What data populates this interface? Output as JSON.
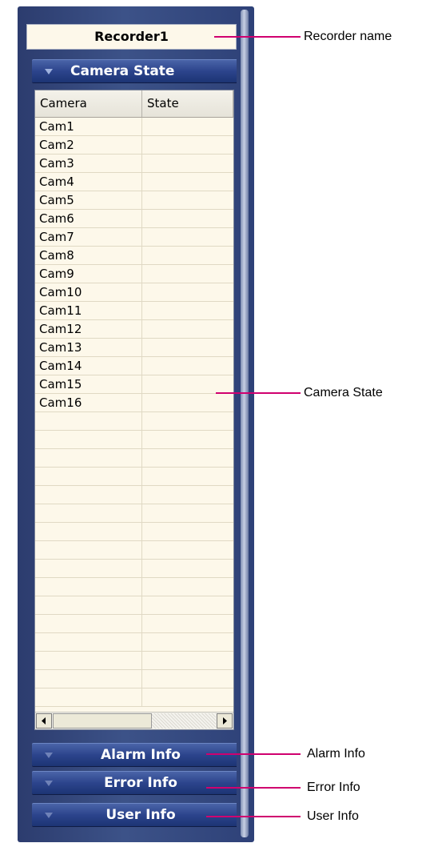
{
  "recorder": {
    "name": "Recorder1"
  },
  "sections": {
    "camera_state": "Camera State",
    "alarm_info": "Alarm Info",
    "error_info": "Error Info",
    "user_info": "User Info"
  },
  "table": {
    "columns": [
      "Camera",
      "State"
    ],
    "rows": [
      {
        "camera": "Cam1",
        "state": ""
      },
      {
        "camera": "Cam2",
        "state": ""
      },
      {
        "camera": "Cam3",
        "state": ""
      },
      {
        "camera": "Cam4",
        "state": ""
      },
      {
        "camera": "Cam5",
        "state": ""
      },
      {
        "camera": "Cam6",
        "state": ""
      },
      {
        "camera": "Cam7",
        "state": ""
      },
      {
        "camera": "Cam8",
        "state": ""
      },
      {
        "camera": "Cam9",
        "state": ""
      },
      {
        "camera": "Cam10",
        "state": ""
      },
      {
        "camera": "Cam11",
        "state": ""
      },
      {
        "camera": "Cam12",
        "state": ""
      },
      {
        "camera": "Cam13",
        "state": ""
      },
      {
        "camera": "Cam14",
        "state": ""
      },
      {
        "camera": "Cam15",
        "state": ""
      },
      {
        "camera": "Cam16",
        "state": ""
      },
      {
        "camera": "",
        "state": ""
      },
      {
        "camera": "",
        "state": ""
      },
      {
        "camera": "",
        "state": ""
      },
      {
        "camera": "",
        "state": ""
      },
      {
        "camera": "",
        "state": ""
      },
      {
        "camera": "",
        "state": ""
      },
      {
        "camera": "",
        "state": ""
      },
      {
        "camera": "",
        "state": ""
      },
      {
        "camera": "",
        "state": ""
      },
      {
        "camera": "",
        "state": ""
      },
      {
        "camera": "",
        "state": ""
      },
      {
        "camera": "",
        "state": ""
      },
      {
        "camera": "",
        "state": ""
      },
      {
        "camera": "",
        "state": ""
      },
      {
        "camera": "",
        "state": ""
      },
      {
        "camera": "",
        "state": ""
      }
    ]
  },
  "annotations": {
    "recorder_name": "Recorder name",
    "camera_state": "Camera State",
    "alarm_info": "Alarm Info",
    "error_info": "Error Info",
    "user_info": "User Info"
  },
  "icons": {
    "section_toggle": "triangle-down-icon",
    "scroll_left": "arrow-left-icon",
    "scroll_right": "arrow-right-icon"
  },
  "colors": {
    "panel_blue": "#2c448c",
    "table_background": "#fdf8ea",
    "callout_magenta": "#d0006f"
  }
}
